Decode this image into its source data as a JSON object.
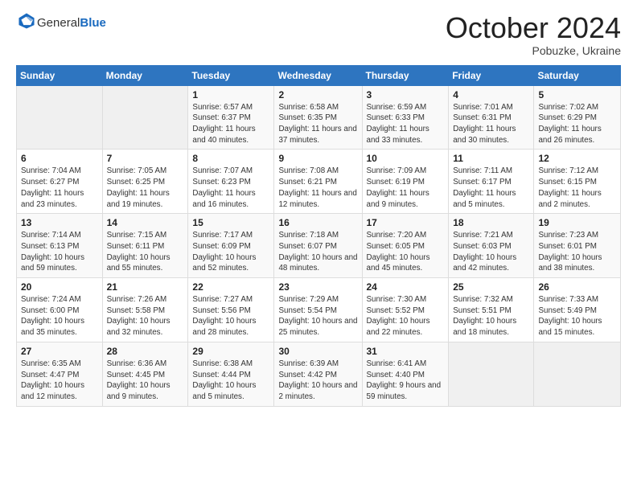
{
  "header": {
    "logo_general": "General",
    "logo_blue": "Blue",
    "month_title": "October 2024",
    "subtitle": "Pobuzke, Ukraine"
  },
  "weekdays": [
    "Sunday",
    "Monday",
    "Tuesday",
    "Wednesday",
    "Thursday",
    "Friday",
    "Saturday"
  ],
  "weeks": [
    [
      {
        "day": "",
        "sunrise": "",
        "sunset": "",
        "daylight": ""
      },
      {
        "day": "",
        "sunrise": "",
        "sunset": "",
        "daylight": ""
      },
      {
        "day": "1",
        "sunrise": "Sunrise: 6:57 AM",
        "sunset": "Sunset: 6:37 PM",
        "daylight": "Daylight: 11 hours and 40 minutes."
      },
      {
        "day": "2",
        "sunrise": "Sunrise: 6:58 AM",
        "sunset": "Sunset: 6:35 PM",
        "daylight": "Daylight: 11 hours and 37 minutes."
      },
      {
        "day": "3",
        "sunrise": "Sunrise: 6:59 AM",
        "sunset": "Sunset: 6:33 PM",
        "daylight": "Daylight: 11 hours and 33 minutes."
      },
      {
        "day": "4",
        "sunrise": "Sunrise: 7:01 AM",
        "sunset": "Sunset: 6:31 PM",
        "daylight": "Daylight: 11 hours and 30 minutes."
      },
      {
        "day": "5",
        "sunrise": "Sunrise: 7:02 AM",
        "sunset": "Sunset: 6:29 PM",
        "daylight": "Daylight: 11 hours and 26 minutes."
      }
    ],
    [
      {
        "day": "6",
        "sunrise": "Sunrise: 7:04 AM",
        "sunset": "Sunset: 6:27 PM",
        "daylight": "Daylight: 11 hours and 23 minutes."
      },
      {
        "day": "7",
        "sunrise": "Sunrise: 7:05 AM",
        "sunset": "Sunset: 6:25 PM",
        "daylight": "Daylight: 11 hours and 19 minutes."
      },
      {
        "day": "8",
        "sunrise": "Sunrise: 7:07 AM",
        "sunset": "Sunset: 6:23 PM",
        "daylight": "Daylight: 11 hours and 16 minutes."
      },
      {
        "day": "9",
        "sunrise": "Sunrise: 7:08 AM",
        "sunset": "Sunset: 6:21 PM",
        "daylight": "Daylight: 11 hours and 12 minutes."
      },
      {
        "day": "10",
        "sunrise": "Sunrise: 7:09 AM",
        "sunset": "Sunset: 6:19 PM",
        "daylight": "Daylight: 11 hours and 9 minutes."
      },
      {
        "day": "11",
        "sunrise": "Sunrise: 7:11 AM",
        "sunset": "Sunset: 6:17 PM",
        "daylight": "Daylight: 11 hours and 5 minutes."
      },
      {
        "day": "12",
        "sunrise": "Sunrise: 7:12 AM",
        "sunset": "Sunset: 6:15 PM",
        "daylight": "Daylight: 11 hours and 2 minutes."
      }
    ],
    [
      {
        "day": "13",
        "sunrise": "Sunrise: 7:14 AM",
        "sunset": "Sunset: 6:13 PM",
        "daylight": "Daylight: 10 hours and 59 minutes."
      },
      {
        "day": "14",
        "sunrise": "Sunrise: 7:15 AM",
        "sunset": "Sunset: 6:11 PM",
        "daylight": "Daylight: 10 hours and 55 minutes."
      },
      {
        "day": "15",
        "sunrise": "Sunrise: 7:17 AM",
        "sunset": "Sunset: 6:09 PM",
        "daylight": "Daylight: 10 hours and 52 minutes."
      },
      {
        "day": "16",
        "sunrise": "Sunrise: 7:18 AM",
        "sunset": "Sunset: 6:07 PM",
        "daylight": "Daylight: 10 hours and 48 minutes."
      },
      {
        "day": "17",
        "sunrise": "Sunrise: 7:20 AM",
        "sunset": "Sunset: 6:05 PM",
        "daylight": "Daylight: 10 hours and 45 minutes."
      },
      {
        "day": "18",
        "sunrise": "Sunrise: 7:21 AM",
        "sunset": "Sunset: 6:03 PM",
        "daylight": "Daylight: 10 hours and 42 minutes."
      },
      {
        "day": "19",
        "sunrise": "Sunrise: 7:23 AM",
        "sunset": "Sunset: 6:01 PM",
        "daylight": "Daylight: 10 hours and 38 minutes."
      }
    ],
    [
      {
        "day": "20",
        "sunrise": "Sunrise: 7:24 AM",
        "sunset": "Sunset: 6:00 PM",
        "daylight": "Daylight: 10 hours and 35 minutes."
      },
      {
        "day": "21",
        "sunrise": "Sunrise: 7:26 AM",
        "sunset": "Sunset: 5:58 PM",
        "daylight": "Daylight: 10 hours and 32 minutes."
      },
      {
        "day": "22",
        "sunrise": "Sunrise: 7:27 AM",
        "sunset": "Sunset: 5:56 PM",
        "daylight": "Daylight: 10 hours and 28 minutes."
      },
      {
        "day": "23",
        "sunrise": "Sunrise: 7:29 AM",
        "sunset": "Sunset: 5:54 PM",
        "daylight": "Daylight: 10 hours and 25 minutes."
      },
      {
        "day": "24",
        "sunrise": "Sunrise: 7:30 AM",
        "sunset": "Sunset: 5:52 PM",
        "daylight": "Daylight: 10 hours and 22 minutes."
      },
      {
        "day": "25",
        "sunrise": "Sunrise: 7:32 AM",
        "sunset": "Sunset: 5:51 PM",
        "daylight": "Daylight: 10 hours and 18 minutes."
      },
      {
        "day": "26",
        "sunrise": "Sunrise: 7:33 AM",
        "sunset": "Sunset: 5:49 PM",
        "daylight": "Daylight: 10 hours and 15 minutes."
      }
    ],
    [
      {
        "day": "27",
        "sunrise": "Sunrise: 6:35 AM",
        "sunset": "Sunset: 4:47 PM",
        "daylight": "Daylight: 10 hours and 12 minutes."
      },
      {
        "day": "28",
        "sunrise": "Sunrise: 6:36 AM",
        "sunset": "Sunset: 4:45 PM",
        "daylight": "Daylight: 10 hours and 9 minutes."
      },
      {
        "day": "29",
        "sunrise": "Sunrise: 6:38 AM",
        "sunset": "Sunset: 4:44 PM",
        "daylight": "Daylight: 10 hours and 5 minutes."
      },
      {
        "day": "30",
        "sunrise": "Sunrise: 6:39 AM",
        "sunset": "Sunset: 4:42 PM",
        "daylight": "Daylight: 10 hours and 2 minutes."
      },
      {
        "day": "31",
        "sunrise": "Sunrise: 6:41 AM",
        "sunset": "Sunset: 4:40 PM",
        "daylight": "Daylight: 9 hours and 59 minutes."
      },
      {
        "day": "",
        "sunrise": "",
        "sunset": "",
        "daylight": ""
      },
      {
        "day": "",
        "sunrise": "",
        "sunset": "",
        "daylight": ""
      }
    ]
  ]
}
